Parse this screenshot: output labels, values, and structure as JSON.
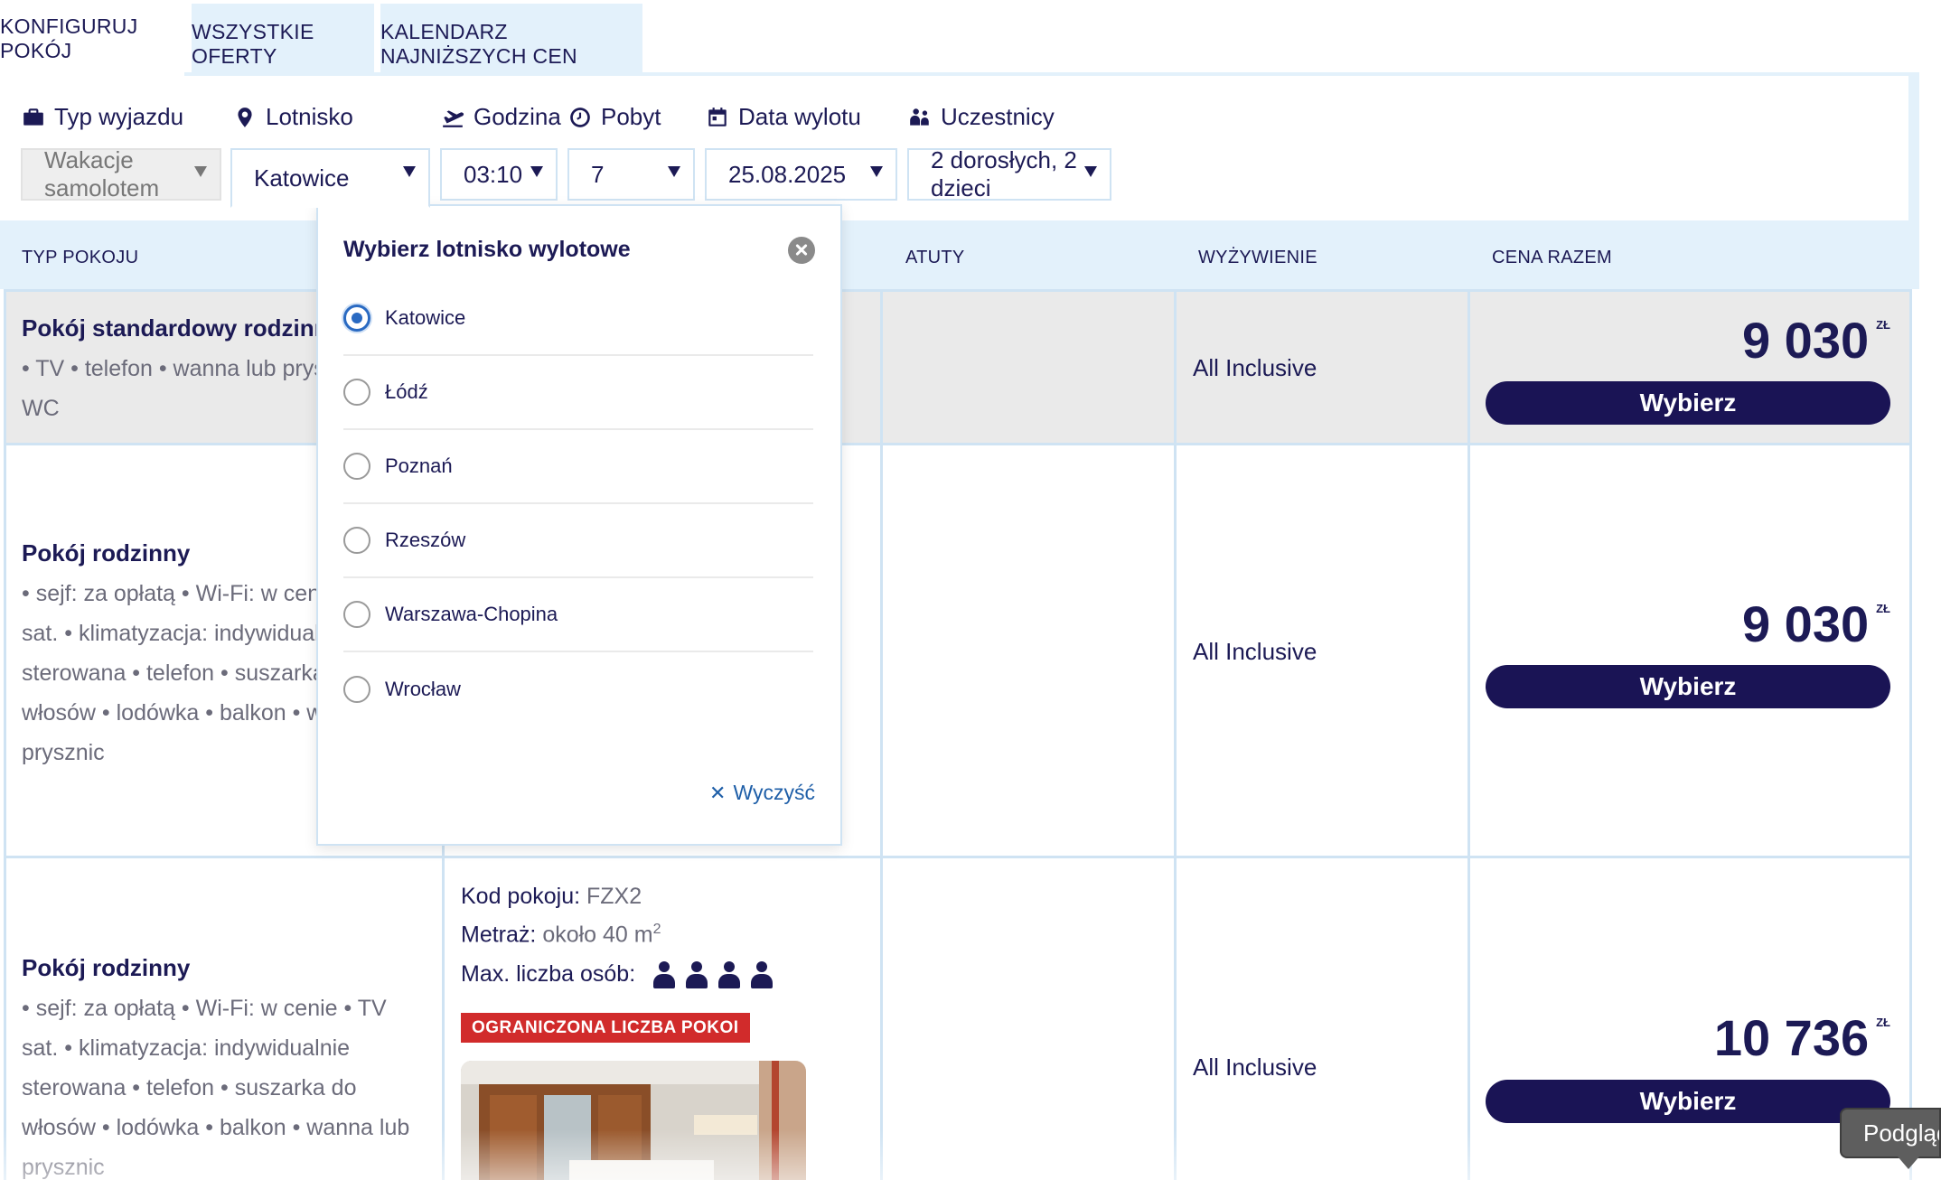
{
  "tabs": [
    {
      "label": "KONFIGURUJ POKÓJ",
      "active": true
    },
    {
      "label": "WSZYSTKIE OFERTY",
      "active": false
    },
    {
      "label": "KALENDARZ NAJNIŻSZYCH CEN",
      "active": false
    }
  ],
  "filters": {
    "trip_type": {
      "label": "Typ wyjazdu",
      "value": "Wakacje samolotem",
      "icon": "briefcase-icon",
      "disabled": true
    },
    "airport": {
      "label": "Lotnisko",
      "value": "Katowice",
      "icon": "location-pin-icon"
    },
    "time": {
      "label": "Godzina",
      "value": "03:10",
      "icon": "plane-departure-icon"
    },
    "stay": {
      "label": "Pobyt",
      "value": "7",
      "icon": "clock-icon"
    },
    "departure_date": {
      "label": "Data wylotu",
      "value": "25.08.2025",
      "icon": "calendar-icon"
    },
    "participants": {
      "label": "Uczestnicy",
      "value": "2 dorosłych, 2 dzieci",
      "icon": "people-icon"
    }
  },
  "table": {
    "headers": {
      "room_type": "TYP POKOJU",
      "advantages": "ATUTY",
      "board": "WYŻYWIENIE",
      "total_price": "CENA RAZEM"
    },
    "rows": [
      {
        "title": "Pokój standardowy rodzinny",
        "features": "• TV • telefon • wanna lub prysznic • WC",
        "board": "All Inclusive",
        "price": "9 030",
        "currency": "ZŁ",
        "button": "Wybierz"
      },
      {
        "title": "Pokój rodzinny",
        "features": "• sejf: za opłatą • Wi-Fi: w cenie • TV sat. • klimatyzacja: indywidualnie sterowana • telefon • suszarka do włosów • lodówka • balkon • wanna lub prysznic",
        "board": "All Inclusive",
        "price": "9 030",
        "currency": "ZŁ",
        "button": "Wybierz"
      },
      {
        "title": "Pokój rodzinny",
        "features": "• sejf: za opłatą • Wi-Fi: w cenie • TV sat. • klimatyzacja: indywidualnie sterowana • telefon • suszarka do włosów • lodówka • balkon • wanna lub prysznic",
        "board": "All Inclusive",
        "price": "10 736",
        "currency": "ZŁ",
        "button": "Wybierz",
        "details": {
          "code_label": "Kod pokoju:",
          "code": "FZX2",
          "area_label": "Metraż:",
          "area": "około 40 m",
          "area_sup": "2",
          "max_label": "Max. liczba osób:",
          "max_persons": 4,
          "badge": "OGRANICZONA LICZBA POKOI"
        }
      }
    ]
  },
  "airport_dropdown": {
    "title": "Wybierz lotnisko wylotowe",
    "options": [
      {
        "label": "Katowice",
        "selected": true
      },
      {
        "label": "Łódź",
        "selected": false
      },
      {
        "label": "Poznań",
        "selected": false
      },
      {
        "label": "Rzeszów",
        "selected": false
      },
      {
        "label": "Warszawa-Chopina",
        "selected": false
      },
      {
        "label": "Wrocław",
        "selected": false
      }
    ],
    "clear_label": "Wyczyść"
  },
  "tooltip": {
    "text": "Podgląd"
  },
  "colors": {
    "navy": "#1a1455",
    "light_blue": "#e3f1fb",
    "border_blue": "#cfe3f3",
    "badge_red": "#d12b2b",
    "radio_blue": "#2a6ac2"
  }
}
